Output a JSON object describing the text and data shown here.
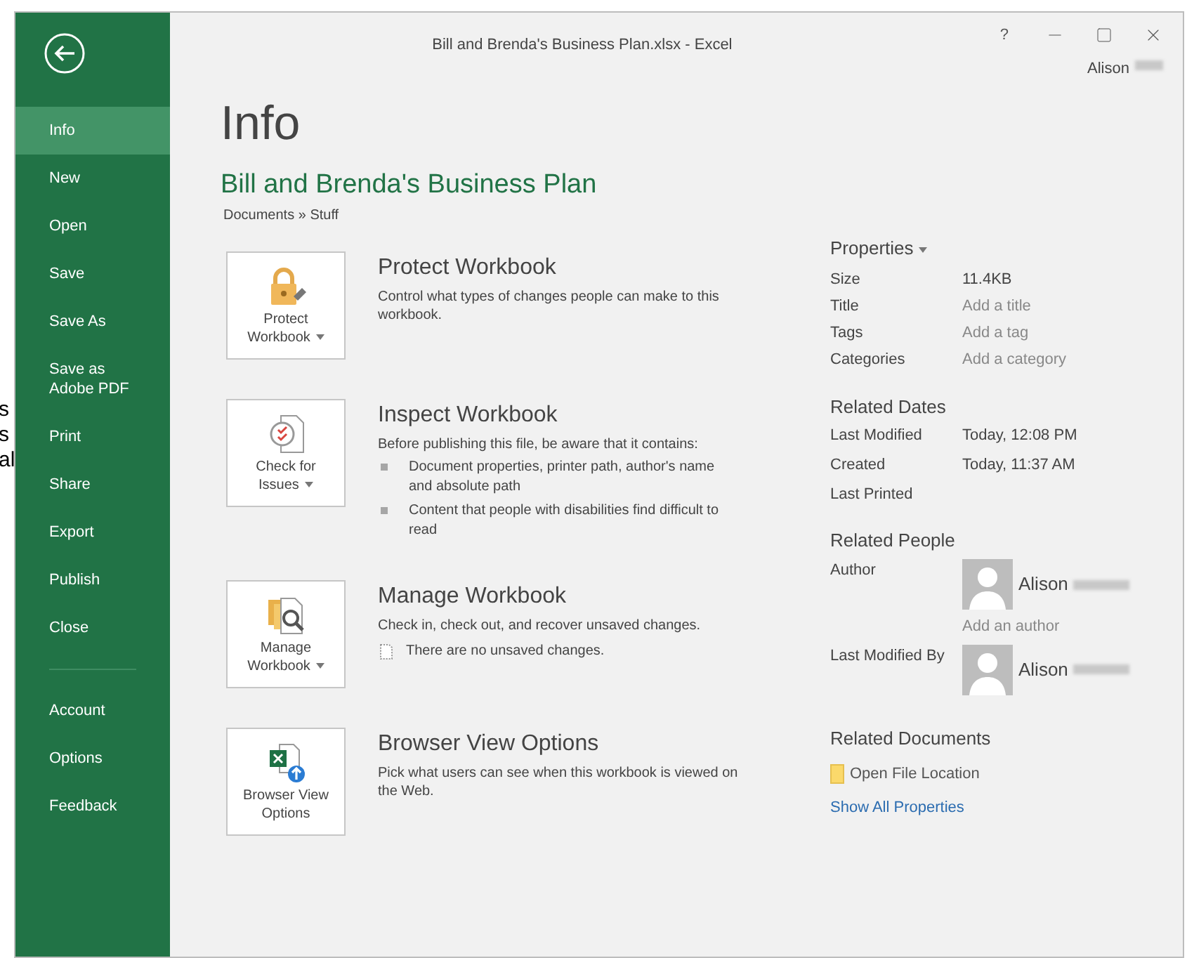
{
  "background_fragments": [
    "s",
    "s",
    "al"
  ],
  "window": {
    "title": "Bill and Brenda's Business Plan.xlsx - Excel",
    "help": "?",
    "user": "Alison"
  },
  "sidebar": {
    "items": [
      {
        "label": "Info",
        "selected": true
      },
      {
        "label": "New",
        "selected": false
      },
      {
        "label": "Open",
        "selected": false
      },
      {
        "label": "Save",
        "selected": false
      },
      {
        "label": "Save As",
        "selected": false
      },
      {
        "label": "Save as Adobe PDF",
        "selected": false
      },
      {
        "label": "Print",
        "selected": false
      },
      {
        "label": "Share",
        "selected": false
      },
      {
        "label": "Export",
        "selected": false
      },
      {
        "label": "Publish",
        "selected": false
      },
      {
        "label": "Close",
        "selected": false
      }
    ],
    "bottom_items": [
      {
        "label": "Account",
        "selected": false
      },
      {
        "label": "Options",
        "selected": false
      },
      {
        "label": "Feedback",
        "selected": false
      }
    ]
  },
  "page": {
    "heading": "Info",
    "document_title": "Bill and Brenda's Business Plan",
    "path": "Documents » Stuff"
  },
  "sections": [
    {
      "kind": "protect",
      "button_lines": [
        "Protect",
        "Workbook"
      ],
      "has_menu": true,
      "title": "Protect Workbook",
      "description": "Control what types of changes people can make to this workbook."
    },
    {
      "kind": "inspect",
      "button_lines": [
        "Check for",
        "Issues"
      ],
      "has_menu": true,
      "title": "Inspect Workbook",
      "description": "Before publishing this file, be aware that it contains:",
      "bullets": [
        "Document properties, printer path, author's name and absolute path",
        "Content that people with disabilities find difficult to read"
      ]
    },
    {
      "kind": "manage",
      "button_lines": [
        "Manage",
        "Workbook"
      ],
      "has_menu": true,
      "title": "Manage Workbook",
      "description": "Check in, check out, and recover unsaved changes.",
      "note": "There are no unsaved changes."
    },
    {
      "kind": "browser",
      "button_lines": [
        "Browser View",
        "Options"
      ],
      "has_menu": false,
      "title": "Browser View Options",
      "description": "Pick what users can see when this workbook is viewed on the Web."
    }
  ],
  "properties": {
    "heading": "Properties",
    "rows": [
      {
        "label": "Size",
        "value": "11.4KB"
      },
      {
        "label": "Title",
        "placeholder": "Add a title"
      },
      {
        "label": "Tags",
        "placeholder": "Add a tag"
      },
      {
        "label": "Categories",
        "placeholder": "Add a category"
      }
    ]
  },
  "related_dates": {
    "heading": "Related Dates",
    "rows": [
      {
        "label": "Last Modified",
        "value": "Today, 12:08 PM"
      },
      {
        "label": "Created",
        "value": "Today, 11:37 AM"
      },
      {
        "label": "Last Printed"
      }
    ]
  },
  "related_people": {
    "heading": "Related People",
    "people": [
      {
        "label": "Author",
        "name": "Alison"
      },
      {
        "label": "Last Modified By",
        "name": "Alison"
      }
    ],
    "add_author": "Add an author"
  },
  "related_documents": {
    "heading": "Related Documents",
    "open_location": "Open File Location",
    "show_all": "Show All Properties"
  }
}
